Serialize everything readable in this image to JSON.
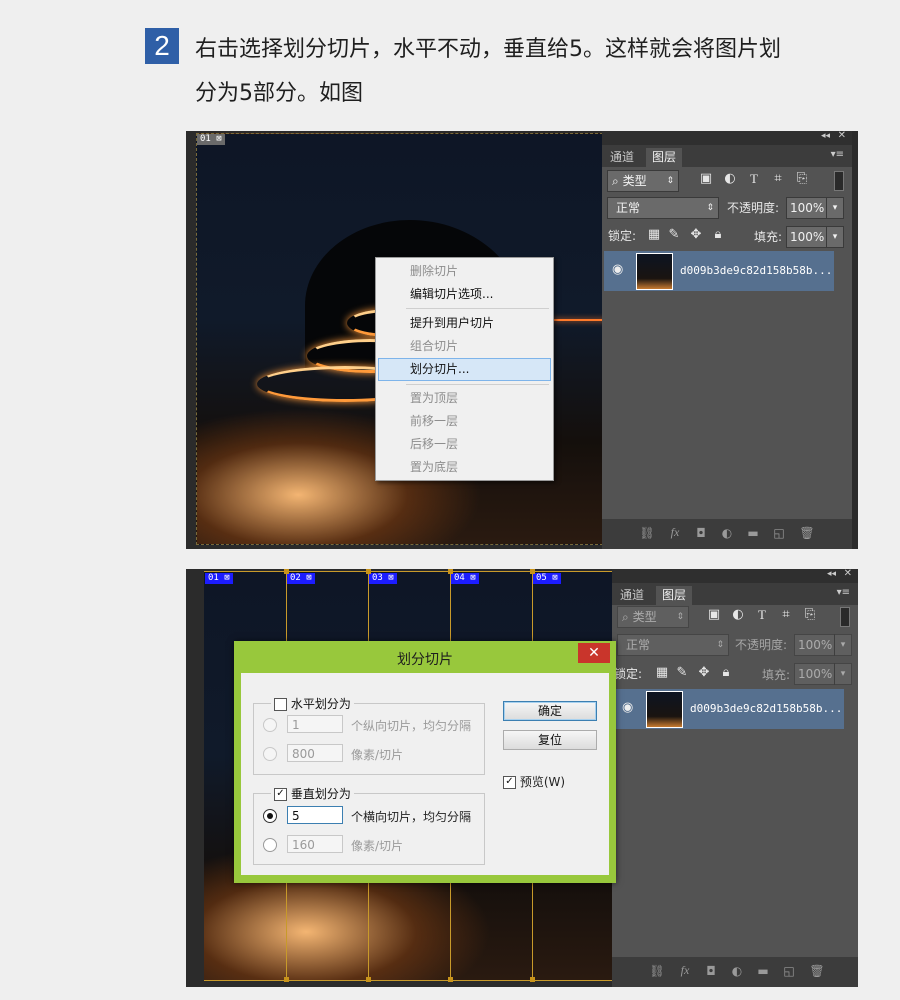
{
  "step": {
    "number": "2",
    "line1": "右击选择划分切片，水平不动，垂直给5。这样就会将图片划",
    "line2": "分为5部分。如图"
  },
  "shot1": {
    "slice_tag": "01",
    "context_menu": {
      "items": [
        {
          "label": "删除切片",
          "enabled": false
        },
        {
          "label": "编辑切片选项...",
          "enabled": true
        },
        {
          "label": "提升到用户切片",
          "enabled": true
        },
        {
          "label": "组合切片",
          "enabled": false
        },
        {
          "label": "划分切片...",
          "enabled": true,
          "highlighted": true
        },
        {
          "label": "置为顶层",
          "enabled": false
        },
        {
          "label": "前移一层",
          "enabled": false
        },
        {
          "label": "后移一层",
          "enabled": false
        },
        {
          "label": "置为底层",
          "enabled": false
        }
      ]
    }
  },
  "shot2": {
    "slice_tags": [
      "01",
      "02",
      "03",
      "04",
      "05"
    ],
    "dialog": {
      "title": "划分切片",
      "close": "✕",
      "horizontal": {
        "label": "水平划分为",
        "checked": false,
        "count_value": "1",
        "count_hint": "个纵向切片，均匀分隔",
        "pixel_value": "800",
        "pixel_hint": "像素/切片"
      },
      "vertical": {
        "label": "垂直划分为",
        "checked": true,
        "count_value": "5",
        "count_hint": "个横向切片，均匀分隔",
        "pixel_value": "160",
        "pixel_hint": "像素/切片"
      },
      "ok_label": "确定",
      "reset_label": "复位",
      "preview_label": "预览(W)",
      "preview_checked": true
    }
  },
  "layers_panel": {
    "tabs": [
      "通道",
      "图层"
    ],
    "active_tab": "图层",
    "filter_kind": "类型",
    "blend_mode": "正常",
    "opacity_label": "不透明度:",
    "opacity_value": "100%",
    "lock_label": "锁定:",
    "fill_label": "填充:",
    "fill_value": "100%",
    "layer_name": "d009b3de9c82d158b58b..."
  },
  "colors": {
    "step_badge": "#2f5fa7",
    "dialog_frame": "#98c83c",
    "close_button": "#c9352b",
    "slice_tag": "#1c1cff",
    "selected_layer": "#56708f"
  }
}
